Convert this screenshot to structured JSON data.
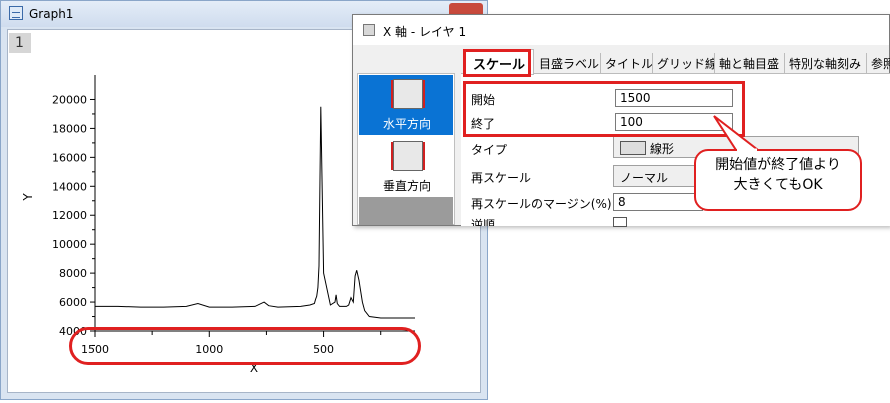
{
  "graph_window": {
    "title": "Graph1",
    "layer_number": "1",
    "icon": "graph-window-icon"
  },
  "chart_data": {
    "type": "line",
    "xlabel": "X",
    "ylabel": "Y",
    "xlim": [
      1500,
      100
    ],
    "ylim": [
      4000,
      21000
    ],
    "x_ticks": [
      "1500",
      "1000",
      "500"
    ],
    "y_ticks": [
      "4000",
      "6000",
      "8000",
      "10000",
      "12000",
      "14000",
      "16000",
      "18000",
      "20000"
    ],
    "series": [
      {
        "x": [
          1500,
          1400,
          1300,
          1200,
          1100,
          1050,
          1000,
          900,
          800,
          760,
          740,
          700,
          600,
          560,
          540,
          535,
          530,
          525,
          520,
          512,
          500,
          470,
          450,
          445,
          440,
          430,
          400,
          390,
          380,
          370,
          362,
          355,
          345,
          340,
          330,
          320,
          300,
          250,
          200,
          150,
          100
        ],
        "y": [
          5700,
          5700,
          5650,
          5650,
          5700,
          5900,
          5650,
          5650,
          5700,
          6000,
          5750,
          5650,
          5700,
          5800,
          5900,
          6200,
          6400,
          7000,
          8500,
          19500,
          8000,
          5800,
          6000,
          6500,
          5900,
          5700,
          5700,
          5800,
          6300,
          6000,
          7800,
          8200,
          7500,
          7000,
          6000,
          5400,
          5000,
          4900,
          4900,
          4900,
          4900
        ]
      }
    ]
  },
  "dialog": {
    "title": "X 軸 - レイヤ 1",
    "icon": "dialog-icon",
    "side_items": [
      {
        "label": "水平方向",
        "icon": "horizontal-axis-icon"
      },
      {
        "label": "垂直方向",
        "icon": "vertical-axis-icon"
      }
    ],
    "tabs": [
      "スケール",
      "目盛ラベル",
      "タイトル",
      "グリッド線",
      "軸と軸目盛",
      "特別な軸刻み",
      "参照"
    ],
    "fields": {
      "start_label": "開始",
      "start_value": "1500",
      "end_label": "終了",
      "end_value": "100",
      "type_label": "タイプ",
      "type_value": "線形",
      "rescale_label": "再スケール",
      "rescale_value": "ノーマル",
      "margin_label": "再スケールのマージン(%)",
      "margin_value": "8",
      "reverse_label": "逆順"
    }
  },
  "callout": {
    "line1": "開始値が終了値より",
    "line2": "大きくてもOK"
  },
  "colors": {
    "annotation": "#e02020",
    "selected": "#0a73d4"
  }
}
